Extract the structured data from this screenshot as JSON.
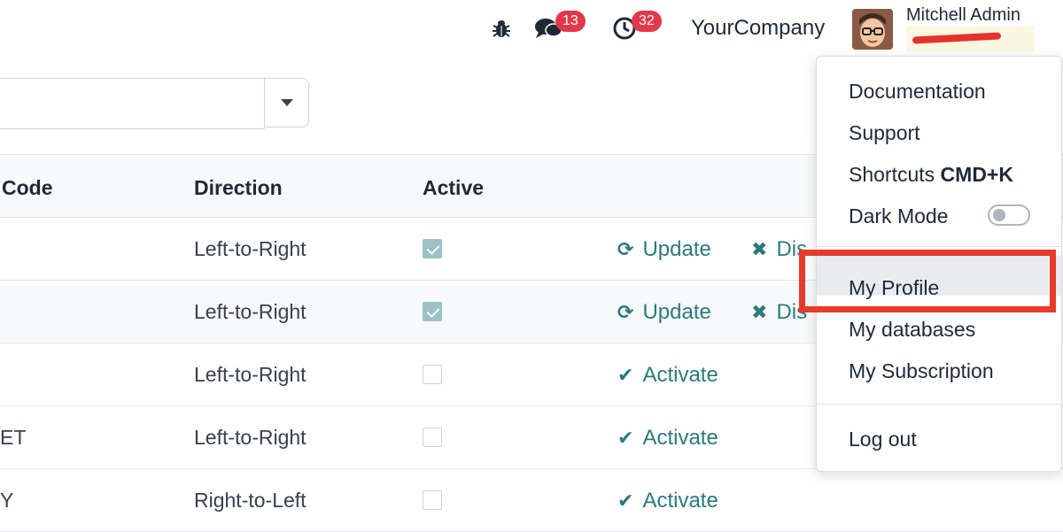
{
  "navbar": {
    "bug_icon": "bug-icon",
    "messages_icon": "chat-bubbles-icon",
    "messages_count": "13",
    "activities_icon": "clock-icon",
    "activities_count": "32",
    "company": "YourCompany",
    "user_name": "Mitchell Admin"
  },
  "search": {
    "toggle_icon": "caret-down-icon"
  },
  "table": {
    "headers": {
      "code": "Code",
      "direction": "Direction",
      "active": "Active"
    },
    "rows": [
      {
        "code": "",
        "direction": "Left-to-Right",
        "active": true,
        "action1": "Update",
        "action2": "Dis"
      },
      {
        "code": "",
        "direction": "Left-to-Right",
        "active": true,
        "action1": "Update",
        "action2": "Dis"
      },
      {
        "code": "",
        "direction": "Left-to-Right",
        "active": false,
        "action1": "Activate"
      },
      {
        "code": "ET",
        "direction": "Left-to-Right",
        "active": false,
        "action1": "Activate"
      },
      {
        "code": "Y",
        "direction": "Right-to-Left",
        "active": false,
        "action1": "Activate"
      }
    ]
  },
  "dropdown": {
    "documentation": "Documentation",
    "support": "Support",
    "shortcuts": "Shortcuts",
    "shortcuts_key": "CMD+K",
    "dark_mode": "Dark Mode",
    "dark_mode_on": false,
    "my_profile": "My Profile",
    "my_databases": "My databases",
    "my_subscription": "My Subscription",
    "log_out": "Log out"
  },
  "colors": {
    "accent": "#2b7a7e",
    "badge": "#e0394b",
    "highlight": "#e63b2a"
  }
}
